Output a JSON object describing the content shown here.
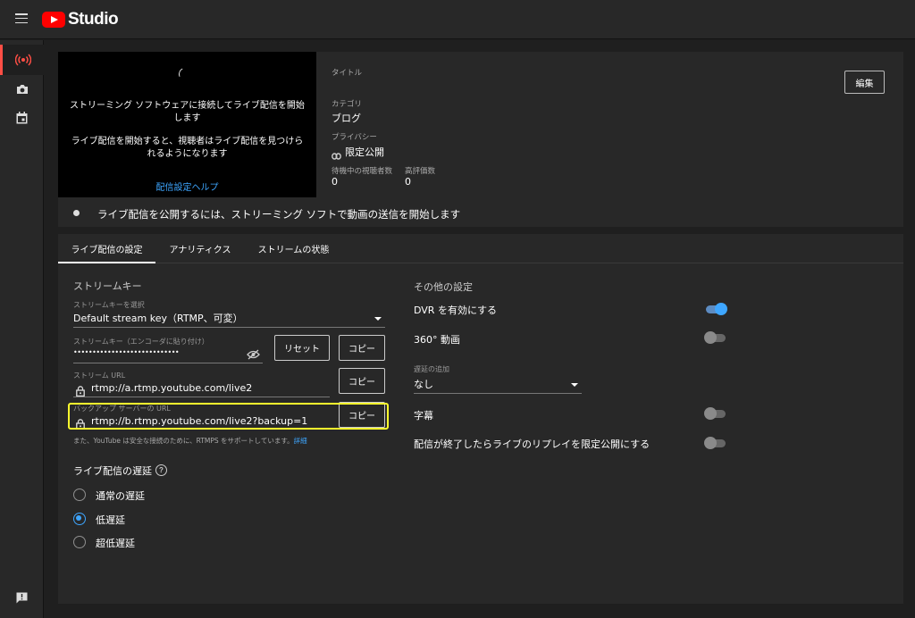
{
  "app": {
    "title": "Studio"
  },
  "preview": {
    "line1": "ストリーミング ソフトウェアに接続してライブ配信を開始",
    "line2": "します",
    "line3": "ライブ配信を開始すると、視聴者はライブ配信を見つけら",
    "line4": "れるようになります",
    "help_link": "配信設定ヘルプ"
  },
  "details": {
    "title_label": "タイトル",
    "category_label": "カテゴリ",
    "category_value": "ブログ",
    "privacy_label": "プライバシー",
    "privacy_value": "限定公開",
    "viewers_label": "待機中の視聴者数",
    "viewers_value": "0",
    "likes_label": "高評価数",
    "likes_value": "0",
    "edit_button": "編集"
  },
  "status": {
    "message": "ライブ配信を公開するには、ストリーミング ソフトで動画の送信を開始します"
  },
  "tabs": [
    {
      "label": "ライブ配信の設定",
      "active": true
    },
    {
      "label": "アナリティクス",
      "active": false
    },
    {
      "label": "ストリームの状態",
      "active": false
    }
  ],
  "stream_key": {
    "section_title": "ストリームキー",
    "select_label": "ストリームキーを選択",
    "select_value": "Default stream key（RTMP、可変）",
    "key_label": "ストリームキー（エンコーダに貼り付け）",
    "key_value": "••••••••••••••••••••••••••••",
    "reset_button": "リセット",
    "copy_button": "コピー",
    "url_label": "ストリーム URL",
    "url_value": "rtmp://a.rtmp.youtube.com/live2",
    "backup_label": "バックアップ サーバーの URL",
    "backup_value": "rtmp://b.rtmp.youtube.com/live2?backup=1",
    "note": "また、YouTube は安全な接続のために、RTMPS をサポートしています。",
    "note_link": "詳細"
  },
  "latency": {
    "title": "ライブ配信の遅延",
    "options": [
      {
        "label": "通常の遅延",
        "selected": false
      },
      {
        "label": "低遅延",
        "selected": true
      },
      {
        "label": "超低遅延",
        "selected": false
      }
    ]
  },
  "other_settings": {
    "title": "その他の設定",
    "dvr_label": "DVR を有効にする",
    "dvr_on": true,
    "video360_label": "360° 動画",
    "video360_on": false,
    "delay_label": "遅延の追加",
    "delay_value": "なし",
    "captions_label": "字幕",
    "captions_on": false,
    "replay_label": "配信が終了したらライブのリプレイを限定公開にする",
    "replay_on": false
  },
  "colors": {
    "accent": "#3ea6ff",
    "brand": "#ff0000",
    "highlight": "#ffff2e"
  },
  "icons": {
    "menu": "hamburger-menu-icon",
    "live": "live-broadcast-icon",
    "camera": "camera-icon",
    "calendar": "calendar-icon",
    "feedback": "feedback-icon",
    "visibility": "visibility-off-icon",
    "lock": "lock-icon",
    "link": "link-icon",
    "help": "help-icon"
  }
}
